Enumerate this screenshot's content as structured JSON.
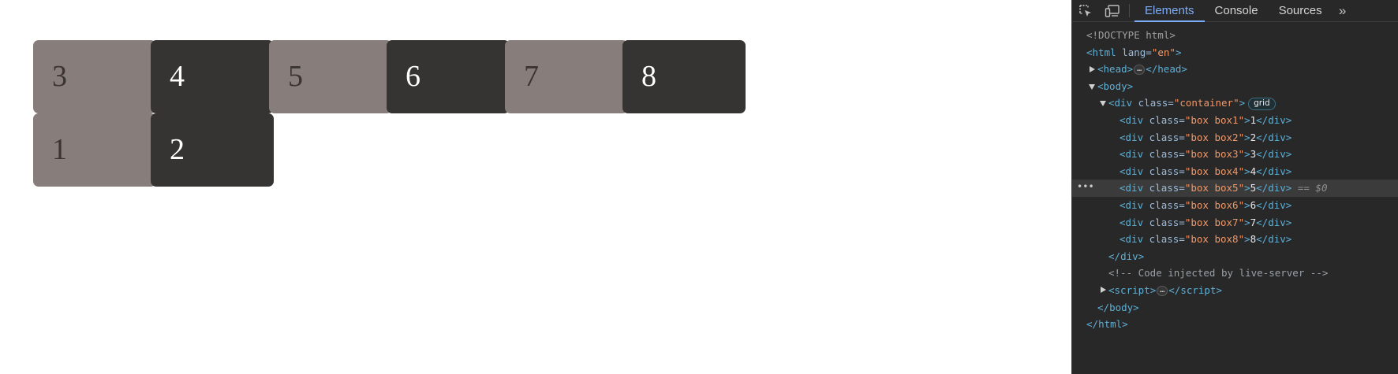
{
  "page": {
    "boxes": [
      {
        "label": "3",
        "shade": "light"
      },
      {
        "label": "4",
        "shade": "dark"
      },
      {
        "label": "5",
        "shade": "light"
      },
      {
        "label": "6",
        "shade": "dark"
      },
      {
        "label": "7",
        "shade": "light"
      },
      {
        "label": "8",
        "shade": "dark"
      },
      {
        "label": "1",
        "shade": "light"
      },
      {
        "label": "2",
        "shade": "dark"
      }
    ]
  },
  "devtools": {
    "tabs": [
      "Elements",
      "Console",
      "Sources"
    ],
    "active_tab": "Elements",
    "more_tabs": "»",
    "tools": [
      "inspect-element-icon",
      "device-toolbar-icon"
    ],
    "dom": {
      "doctype": "<!DOCTYPE html>",
      "html_tag": "html",
      "lang_attr": "lang",
      "lang_val": "en",
      "head_tag": "head",
      "body_tag": "body",
      "div_tag": "div",
      "class_attr": "class",
      "container_class": "container",
      "grid_badge": "grid",
      "ellipsis": "…",
      "children": [
        {
          "class": "box box1",
          "text": "1"
        },
        {
          "class": "box box2",
          "text": "2"
        },
        {
          "class": "box box3",
          "text": "3"
        },
        {
          "class": "box box4",
          "text": "4"
        },
        {
          "class": "box box5",
          "text": "5"
        },
        {
          "class": "box box6",
          "text": "6"
        },
        {
          "class": "box box7",
          "text": "7"
        },
        {
          "class": "box box8",
          "text": "8"
        }
      ],
      "selected_child": "box box5",
      "selected_marker": "== $0",
      "gutter_dots": "•••",
      "comment": "<!-- Code injected by live-server -->",
      "script_tag": "script"
    }
  },
  "colors": {
    "box_light": "#877d7a",
    "box_dark": "#363433",
    "devtools_bg": "#282828",
    "accent": "#7cacf8"
  }
}
